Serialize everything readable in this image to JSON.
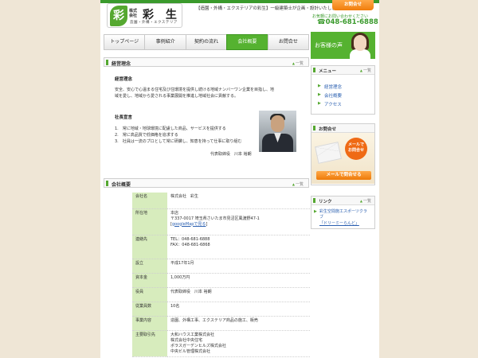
{
  "header": {
    "logo_mark": "彩",
    "logo_sub": "株式会社",
    "logo_name": "彩 生",
    "logo_tag": "造園・外構・エクステリア",
    "tagline": "【造園・外構・エクステリアの彩生】一級建築士が企画・設計いたします",
    "call_button": "お問合せ",
    "tel_label": "お気軽にお問い合わせください",
    "tel_number": "☎048-681-6888"
  },
  "nav": {
    "items": [
      "トップページ",
      "事例紹介",
      "契約の流れ",
      "会社概要",
      "お問合せ"
    ]
  },
  "philosophy": {
    "section_title": "経営理念",
    "top_link": "一覧",
    "heading": "経営理念",
    "text_line1": "安全、安心で心温まる住宅及び住環境を提供し続ける地域ナンバーワン企業を目指し、地",
    "text_line2": "域を愛し、地域から愛される事業展開を推進し地域社会に貢献する。",
    "declaration_heading": "社長宣言",
    "declaration_1": "1.　常に地域・地球環境に配慮した商品、サービスを提供する",
    "declaration_2": "2.　常に高品質で低価格を追求する",
    "declaration_3": "3.　社員は一流のプロとして常に研鑽し、知恵を持って仕事に取り組む",
    "signature": "代表取締役　川本 裕朗"
  },
  "profile": {
    "section_title": "会社概要",
    "top_link": "一覧",
    "rows": [
      {
        "key": "会社名",
        "value": "株式会社　彩生"
      },
      {
        "key": "所在地",
        "value": "本店",
        "value2": "〒337-0017 埼玉県さいたま市見沼区風渡野47-1",
        "link": "googleMapで見る"
      },
      {
        "key": "連絡先",
        "value": "TEL：048-681-6888",
        "value2": "FAX：048-681-6868"
      },
      {
        "key": "設立",
        "value": "平成17年1月"
      },
      {
        "key": "資本金",
        "value": "1,000万円"
      },
      {
        "key": "役員",
        "value": "代表取締役　川本 裕朗"
      },
      {
        "key": "従業員数",
        "value": "10名"
      },
      {
        "key": "事業内容",
        "value": "造園、外構工事、エクステリア商品の施工、販売"
      },
      {
        "key": "主要取引先",
        "value": "大和ハウス工業株式会社",
        "value2": "株式会社中央住宅",
        "value3": "ポラスガーデンヒルズ株式会社",
        "value4": "中央ビル管理株式会社"
      }
    ]
  },
  "sidebar": {
    "voice_label": "お客様の声",
    "menu_title": "メニュー",
    "menu_top": "一覧",
    "menu_items": [
      "経営理念",
      "会社概要",
      "アクセス"
    ],
    "contact_title": "お問合せ",
    "mail_circle_1": "メールで",
    "mail_circle_2": "お問合せ",
    "mail_button": "メールで問合せる",
    "link_title": "リンク",
    "link_top": "一覧",
    "link_text": "彩生空間施工スポーツクラブ",
    "link_text2": "「ドリーミーらんど」"
  }
}
